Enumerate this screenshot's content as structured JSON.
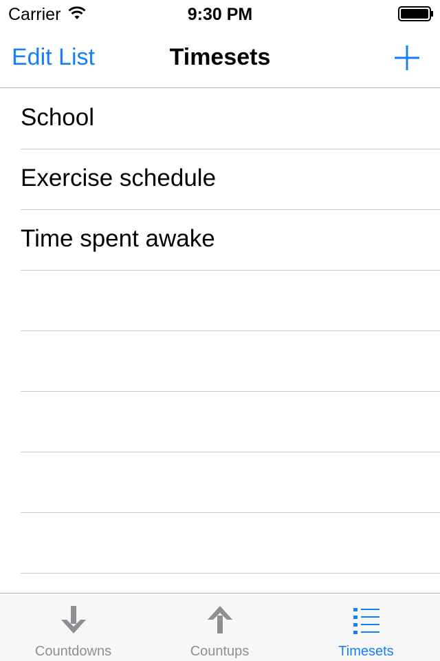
{
  "status_bar": {
    "carrier": "Carrier",
    "time": "9:30 PM"
  },
  "nav_bar": {
    "edit_label": "Edit List",
    "title": "Timesets",
    "add_icon": "plus-icon"
  },
  "list": {
    "items": [
      {
        "label": "School"
      },
      {
        "label": "Exercise schedule"
      },
      {
        "label": "Time spent awake"
      },
      {
        "label": ""
      },
      {
        "label": ""
      },
      {
        "label": ""
      },
      {
        "label": ""
      },
      {
        "label": ""
      }
    ]
  },
  "tab_bar": {
    "tabs": [
      {
        "label": "Countdowns",
        "icon": "arrow-down-icon",
        "active": false
      },
      {
        "label": "Countups",
        "icon": "arrow-up-icon",
        "active": false
      },
      {
        "label": "Timesets",
        "icon": "list-icon",
        "active": true
      }
    ]
  },
  "colors": {
    "accent": "#157efb",
    "inactive_tab": "#8e8e93",
    "separator": "#c8c7cc"
  }
}
